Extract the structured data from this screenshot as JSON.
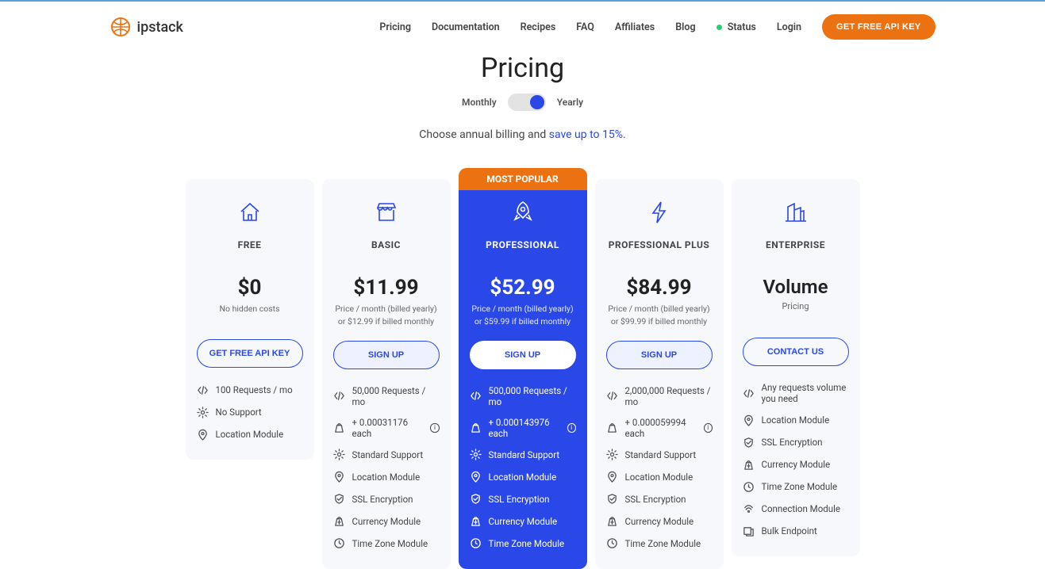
{
  "brand": {
    "name": "ipstack"
  },
  "nav": {
    "items": [
      "Pricing",
      "Documentation",
      "Recipes",
      "FAQ",
      "Affiliates",
      "Blog"
    ],
    "status": "Status",
    "login": "Login",
    "cta": "GET FREE API KEY"
  },
  "header": {
    "title": "Pricing",
    "toggle_left": "Monthly",
    "toggle_right": "Yearly",
    "subtitle_prefix": "Choose annual billing and ",
    "subtitle_link": "save up to 15%",
    "subtitle_suffix": "."
  },
  "plans": {
    "free": {
      "name": "FREE",
      "price": "$0",
      "sub1": "No hidden costs",
      "sub2": "",
      "cta": "GET FREE API KEY",
      "features": [
        {
          "icon": "code",
          "text": "100 Requests / mo"
        },
        {
          "icon": "gear",
          "text": "No Support"
        },
        {
          "icon": "pin",
          "text": "Location Module"
        }
      ]
    },
    "basic": {
      "name": "BASIC",
      "price": "$11.99",
      "sub1": "Price / month (billed yearly)",
      "sub2": "or $12.99 if billed monthly",
      "cta": "SIGN UP",
      "features": [
        {
          "icon": "code",
          "text": "50,000 Requests / mo"
        },
        {
          "icon": "bag",
          "text": "+ 0.00031176 each",
          "info": true
        },
        {
          "icon": "gear",
          "text": "Standard Support"
        },
        {
          "icon": "pin",
          "text": "Location Module"
        },
        {
          "icon": "shield",
          "text": "SSL Encryption"
        },
        {
          "icon": "currency",
          "text": "Currency Module"
        },
        {
          "icon": "clock",
          "text": "Time Zone Module"
        }
      ]
    },
    "pro": {
      "badge": "MOST POPULAR",
      "name": "PROFESSIONAL",
      "price": "$52.99",
      "sub1": "Price / month (billed yearly)",
      "sub2": "or $59.99 if billed monthly",
      "cta": "SIGN UP",
      "features": [
        {
          "icon": "code",
          "text": "500,000 Requests / mo"
        },
        {
          "icon": "bag",
          "text": "+ 0.000143976 each",
          "info": true
        },
        {
          "icon": "gear",
          "text": "Standard Support"
        },
        {
          "icon": "pin",
          "text": "Location Module"
        },
        {
          "icon": "shield",
          "text": "SSL Encryption"
        },
        {
          "icon": "currency",
          "text": "Currency Module"
        },
        {
          "icon": "clock",
          "text": "Time Zone Module"
        }
      ]
    },
    "proplus": {
      "name": "PROFESSIONAL PLUS",
      "price": "$84.99",
      "sub1": "Price / month (billed yearly)",
      "sub2": "or $99.99 if billed monthly",
      "cta": "SIGN UP",
      "features": [
        {
          "icon": "code",
          "text": "2,000,000 Requests / mo"
        },
        {
          "icon": "bag",
          "text": "+ 0.000059994 each",
          "info": true
        },
        {
          "icon": "gear",
          "text": "Standard Support"
        },
        {
          "icon": "pin",
          "text": "Location Module"
        },
        {
          "icon": "shield",
          "text": "SSL Encryption"
        },
        {
          "icon": "currency",
          "text": "Currency Module"
        },
        {
          "icon": "clock",
          "text": "Time Zone Module"
        }
      ]
    },
    "enterprise": {
      "name": "ENTERPRISE",
      "title": "Volume",
      "sub": "Pricing",
      "cta": "CONTACT US",
      "features": [
        {
          "icon": "code",
          "text": "Any requests volume you need"
        },
        {
          "icon": "pin",
          "text": "Location Module"
        },
        {
          "icon": "shield",
          "text": "SSL Encryption"
        },
        {
          "icon": "currency",
          "text": "Currency Module"
        },
        {
          "icon": "clock",
          "text": "Time Zone Module"
        },
        {
          "icon": "signal",
          "text": "Connection Module"
        },
        {
          "icon": "bulk",
          "text": "Bulk Endpoint"
        }
      ]
    }
  }
}
